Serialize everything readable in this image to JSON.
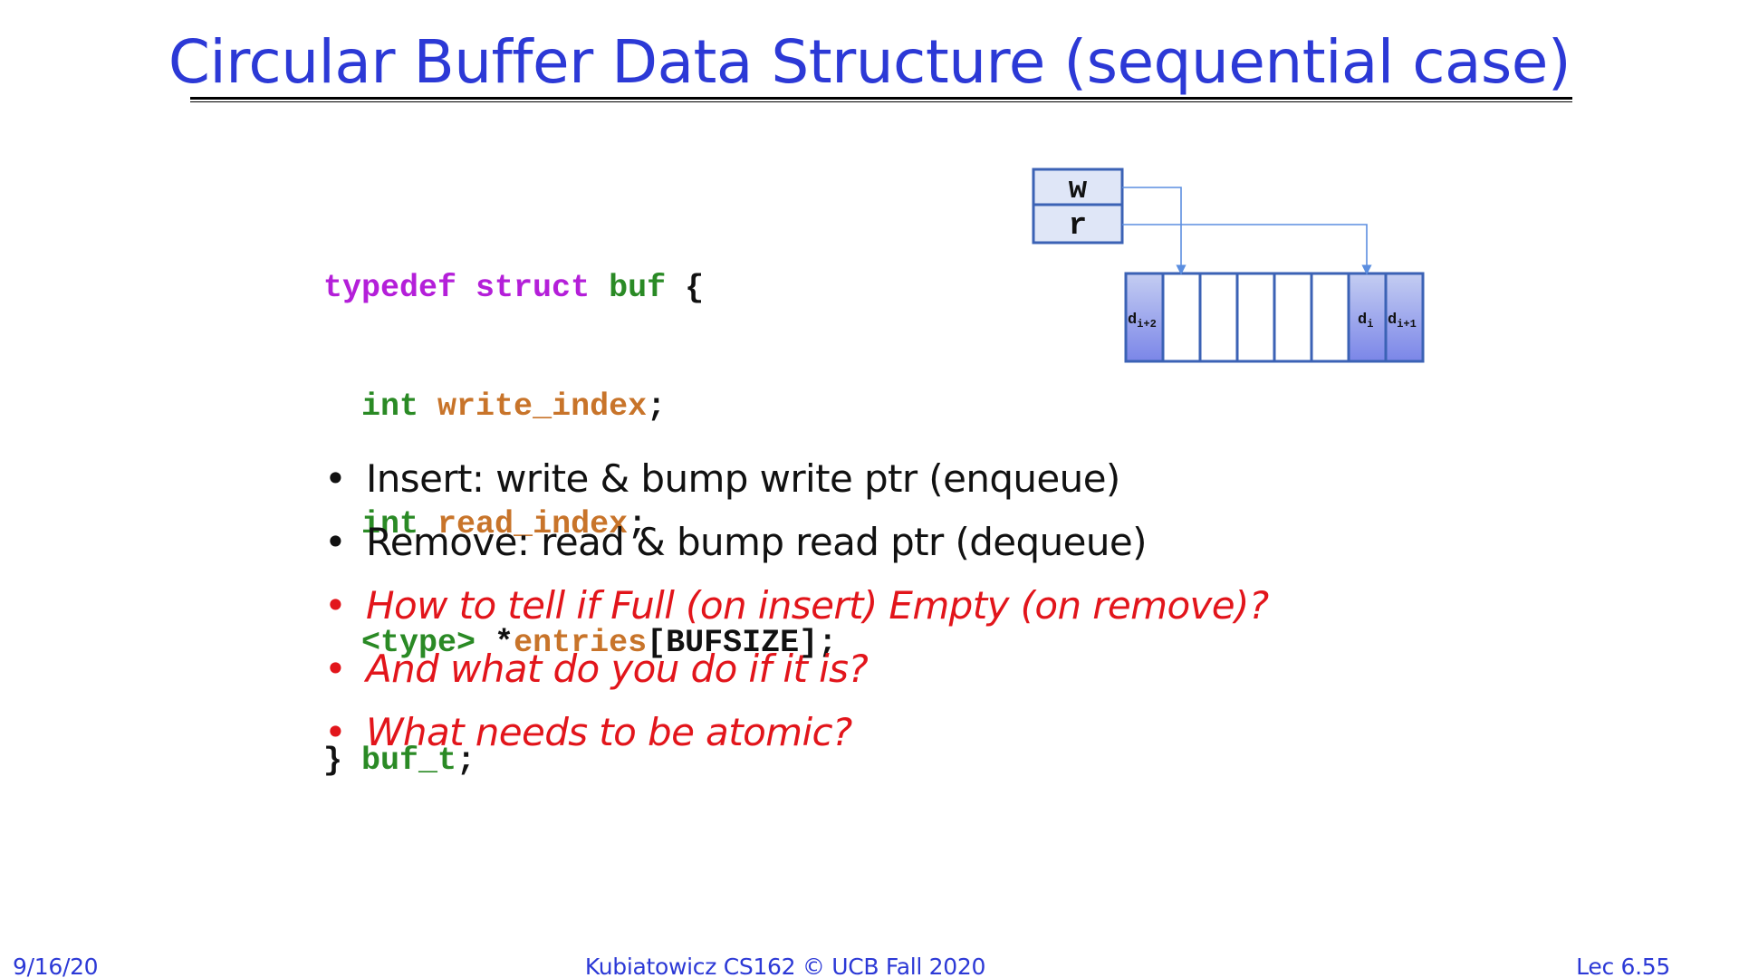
{
  "slide": {
    "title": "Circular Buffer Data Structure (sequential case)"
  },
  "code": {
    "line1": {
      "kw1": "typedef",
      "kw2": "struct",
      "name": "buf",
      "brace": " {"
    },
    "line2": {
      "type": "int",
      "field": "write_index",
      "semi": ";"
    },
    "line3": {
      "type": "int",
      "field": "read_index",
      "semi": ";"
    },
    "line4": {
      "type": "<type>",
      "star": " *",
      "field": "entries",
      "rest": "[BUFSIZE];"
    },
    "line5": {
      "brace": "} ",
      "name": "buf_t",
      "semi": ";"
    }
  },
  "diagram": {
    "pointer_write": "w",
    "pointer_read": "r",
    "cell_labels": {
      "first_base": "d",
      "first_sub": "i+2",
      "di_base": "d",
      "di_sub": "i",
      "dnext_base": "d",
      "dnext_sub": "i+1"
    },
    "colors": {
      "box_fill": "#dfe6f7",
      "border": "#3b62b5",
      "arrow": "#5b8ee0",
      "cell_filled_top": "#c4cdf2",
      "cell_filled_bottom": "#7b86e8"
    }
  },
  "bullets": [
    {
      "text": "Insert: write & bump write ptr (enqueue)",
      "style": "plain"
    },
    {
      "text": "Remove: read & bump read ptr (dequeue)",
      "style": "plain"
    },
    {
      "text": "How to tell if Full (on insert) Empty (on remove)?",
      "style": "red-italic"
    },
    {
      "text": "And what do you do if it is?",
      "style": "red-italic"
    },
    {
      "text": "What needs to be atomic?",
      "style": "red-italic"
    }
  ],
  "bullet_symbol": "•",
  "footer": {
    "date": "9/16/20",
    "course": "Kubiatowicz CS162 © UCB Fall 2020",
    "lecture": "Lec 6.55"
  },
  "colors": {
    "title": "#2c39d6",
    "red_text": "#e2151b",
    "purple_keyword": "#b41fd9",
    "green_keyword": "#2a8a25",
    "orange_identifier": "#c8742a"
  }
}
